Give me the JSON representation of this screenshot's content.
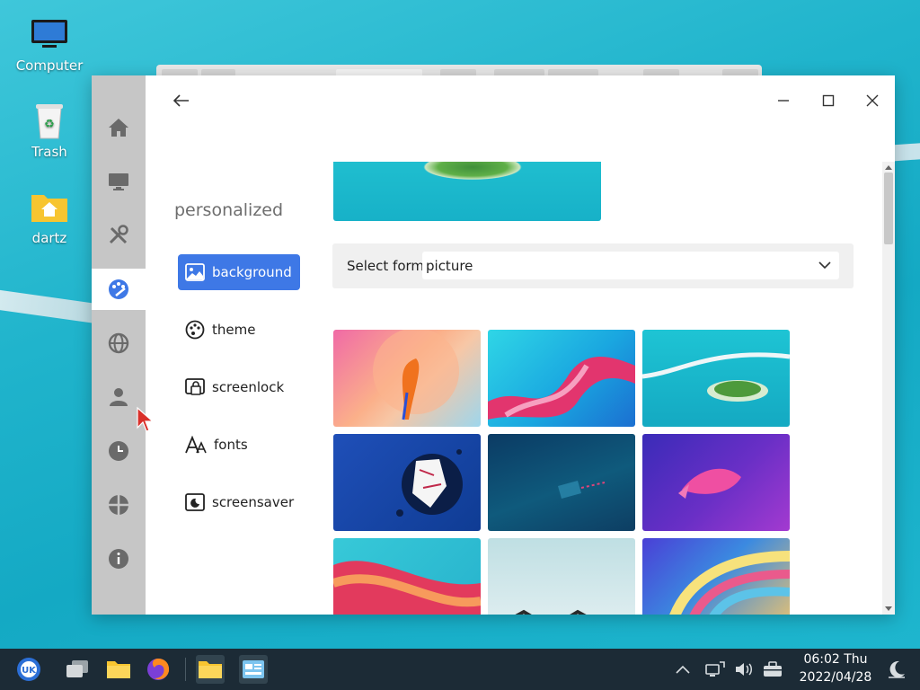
{
  "desktop": {
    "icons": [
      {
        "label": "Computer",
        "icon": "monitor-icon"
      },
      {
        "label": "Trash",
        "icon": "trash-icon"
      },
      {
        "label": "dartz",
        "icon": "home-folder-icon"
      }
    ]
  },
  "settings_window": {
    "section_title": "personalized",
    "rail_icons": [
      "home-icon",
      "display-icon",
      "tools-icon",
      "palette-icon",
      "globe-icon",
      "user-icon",
      "clock-icon",
      "network-icon",
      "info-icon"
    ],
    "rail_active_index": 3,
    "nav": [
      {
        "label": "background",
        "icon": "image-icon",
        "active": true
      },
      {
        "label": "theme",
        "icon": "palette-icon",
        "active": false
      },
      {
        "label": "screenlock",
        "icon": "screenlock-icon",
        "active": false
      },
      {
        "label": "fonts",
        "icon": "font-icon",
        "active": false
      },
      {
        "label": "screensaver",
        "icon": "screensaver-icon",
        "active": false
      }
    ],
    "select_form": {
      "label": "Select form",
      "value": "picture"
    },
    "wallpapers": [
      {
        "name": "pink-abstract"
      },
      {
        "name": "ribbon-pink-teal"
      },
      {
        "name": "island-aerial"
      },
      {
        "name": "blue-splash-art"
      },
      {
        "name": "dark-teal-text"
      },
      {
        "name": "purple-fish"
      },
      {
        "name": "red-wave"
      },
      {
        "name": "white-roof"
      },
      {
        "name": "colorful-swirl"
      }
    ],
    "accent_color": "#3e78e6"
  },
  "taskbar": {
    "time": "06:02 Thu",
    "date": "2022/04/28"
  }
}
